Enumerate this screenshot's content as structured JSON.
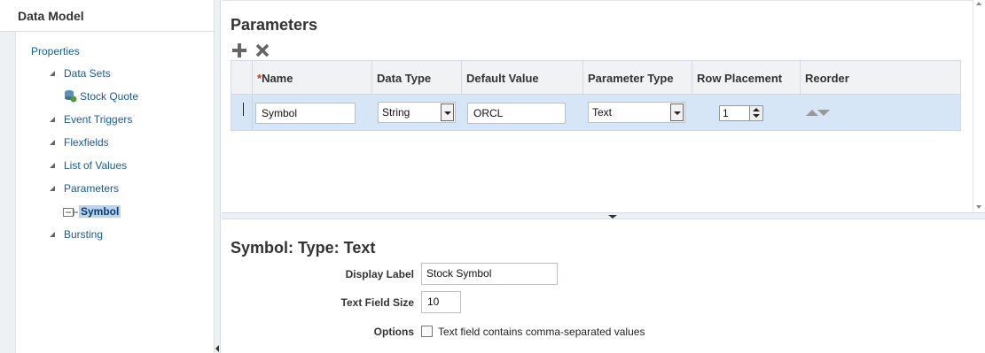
{
  "left_panel": {
    "title": "Data Model",
    "tree": {
      "properties": "Properties",
      "data_sets": "Data Sets",
      "stock_quote": "Stock Quote",
      "event_triggers": "Event Triggers",
      "flexfields": "Flexfields",
      "list_of_values": "List of Values",
      "parameters": "Parameters",
      "symbol": "Symbol",
      "bursting": "Bursting"
    }
  },
  "parameters_section": {
    "title": "Parameters",
    "toolbar": {
      "add_icon": "plus-icon",
      "delete_icon": "x-icon"
    },
    "columns": {
      "required_marker": "*",
      "name": "Name",
      "data_type": "Data Type",
      "default_value": "Default Value",
      "parameter_type": "Parameter Type",
      "row_placement": "Row Placement",
      "reorder": "Reorder"
    },
    "rows": [
      {
        "name": "Symbol",
        "data_type": "String",
        "default_value": "ORCL",
        "parameter_type": "Text",
        "row_placement": "1"
      }
    ]
  },
  "detail": {
    "title": "Symbol: Type: Text",
    "display_label_label": "Display Label",
    "display_label_value": "Stock Symbol",
    "text_field_size_label": "Text Field Size",
    "text_field_size_value": "10",
    "options_label": "Options",
    "options_checkbox_label": "Text field contains comma-separated values",
    "options_checked": false
  },
  "colors": {
    "accent_link": "#145c9e",
    "selected_row": "#d6e6f6",
    "selected_tree": "#bcd3ea"
  }
}
